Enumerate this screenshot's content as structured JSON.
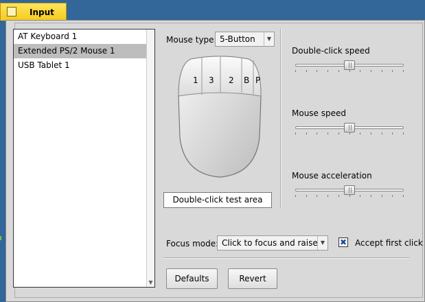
{
  "tab": {
    "title": "Input"
  },
  "devices": [
    {
      "label": "AT Keyboard 1",
      "selected": false
    },
    {
      "label": "Extended PS/2 Mouse 1",
      "selected": true
    },
    {
      "label": "USB Tablet 1",
      "selected": false
    }
  ],
  "mouse_type": {
    "label": "Mouse type:",
    "value": "5-Button"
  },
  "mouse_buttons": [
    "1",
    "3",
    "2",
    "B",
    "P"
  ],
  "test_area": {
    "label": "Double-click test area"
  },
  "sliders": {
    "double_click_speed": {
      "label": "Double-click speed",
      "value": 0.5
    },
    "mouse_speed": {
      "label": "Mouse speed",
      "value": 0.5
    },
    "mouse_acceleration": {
      "label": "Mouse acceleration",
      "value": 0.5
    }
  },
  "focus_mode": {
    "label": "Focus mode:",
    "value": "Click to focus and raise"
  },
  "accept_first_click": {
    "label": "Accept first click",
    "checked": true,
    "mark": "✖"
  },
  "buttons": {
    "defaults": "Defaults",
    "revert": "Revert"
  },
  "colors": {
    "tab": "#f6c91d",
    "desktop": "#336699",
    "window": "#d9d9d9"
  }
}
